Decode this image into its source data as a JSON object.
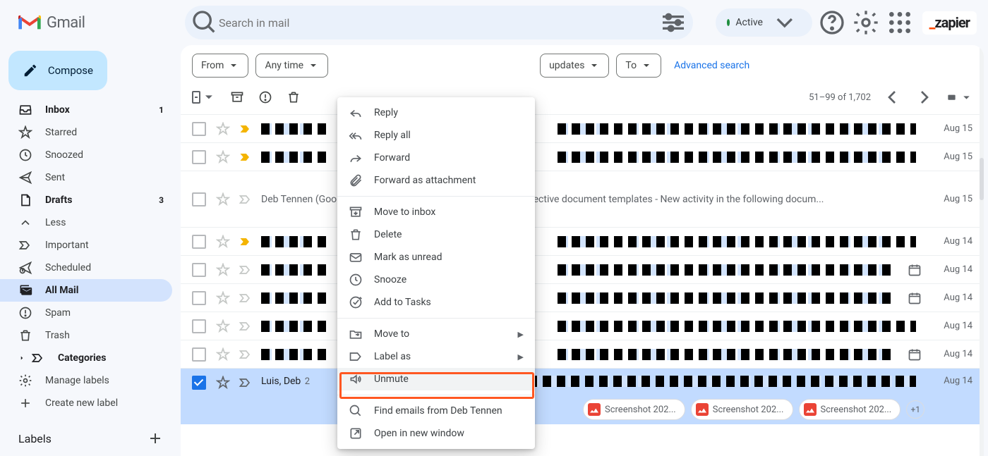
{
  "header": {
    "app_name": "Gmail",
    "search_placeholder": "Search in mail",
    "status_label": "Active",
    "zapier_text": "zapier"
  },
  "compose_label": "Compose",
  "sidebar": {
    "items": [
      {
        "label": "Inbox",
        "count": "1",
        "bold": true
      },
      {
        "label": "Starred"
      },
      {
        "label": "Snoozed"
      },
      {
        "label": "Sent"
      },
      {
        "label": "Drafts",
        "count": "3",
        "bold": true
      },
      {
        "label": "Less"
      },
      {
        "label": "Important"
      },
      {
        "label": "Scheduled"
      },
      {
        "label": "All Mail",
        "active": true
      },
      {
        "label": "Spam"
      },
      {
        "label": "Trash"
      },
      {
        "label": "Categories"
      },
      {
        "label": "Manage labels"
      },
      {
        "label": "Create new label"
      }
    ],
    "labels_header": "Labels"
  },
  "filters": {
    "from": "From",
    "any_time": "Any time",
    "updates": "updates",
    "to": "To",
    "advanced": "Advanced search"
  },
  "pagination": "51–99 of 1,702",
  "context_menu": {
    "reply": "Reply",
    "reply_all": "Reply all",
    "forward": "Forward",
    "forward_attachment": "Forward as attachment",
    "move_inbox": "Move to inbox",
    "delete": "Delete",
    "mark_unread": "Mark as unread",
    "snooze": "Snooze",
    "add_tasks": "Add to Tasks",
    "move_to": "Move to",
    "label_as": "Label as",
    "unmute": "Unmute",
    "find_emails": "Find emails from Deb Tennen",
    "open_window": "Open in new window"
  },
  "rows": [
    {
      "date": "Aug 15",
      "important_yellow": true
    },
    {
      "date": "Aug 15",
      "important_yellow": true
    },
    {
      "sender": "Deb Tennen (Goo",
      "subject": "v to create effective document templates - New activity in the following docum...",
      "date": "Aug 15"
    },
    {
      "date": "Aug 14",
      "important_yellow": true
    },
    {
      "date": "Aug 14",
      "calendar": true
    },
    {
      "date": "Aug 14",
      "calendar": true
    },
    {
      "date": "Aug 14"
    },
    {
      "date": "Aug 14",
      "calendar": true
    },
    {
      "sender": "Luis, Deb",
      "count": "2",
      "date": "Aug 14",
      "selected": true
    }
  ],
  "attachments": {
    "a1": "Screenshot 202...",
    "a2": "Screenshot 202...",
    "a3": "Screenshot 202...",
    "more": "+1"
  }
}
